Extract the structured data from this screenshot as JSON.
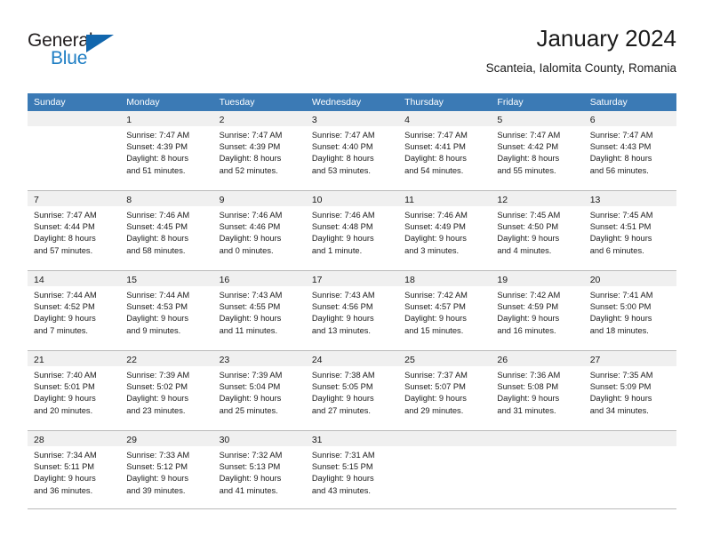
{
  "brand": {
    "name_part1": "General",
    "name_part2": "Blue",
    "logo_icon": "blue-triangle-icon"
  },
  "header": {
    "title": "January 2024",
    "subtitle": "Scanteia, Ialomita County, Romania",
    "accent_color": "#3b7ab5",
    "brand_blue": "#1f7ec4"
  },
  "calendar": {
    "weekday_headers": [
      "Sunday",
      "Monday",
      "Tuesday",
      "Wednesday",
      "Thursday",
      "Friday",
      "Saturday"
    ],
    "weeks": [
      [
        {
          "day": "",
          "sunrise": "",
          "sunset": "",
          "daylight1": "",
          "daylight2": ""
        },
        {
          "day": "1",
          "sunrise": "Sunrise: 7:47 AM",
          "sunset": "Sunset: 4:39 PM",
          "daylight1": "Daylight: 8 hours",
          "daylight2": "and 51 minutes."
        },
        {
          "day": "2",
          "sunrise": "Sunrise: 7:47 AM",
          "sunset": "Sunset: 4:39 PM",
          "daylight1": "Daylight: 8 hours",
          "daylight2": "and 52 minutes."
        },
        {
          "day": "3",
          "sunrise": "Sunrise: 7:47 AM",
          "sunset": "Sunset: 4:40 PM",
          "daylight1": "Daylight: 8 hours",
          "daylight2": "and 53 minutes."
        },
        {
          "day": "4",
          "sunrise": "Sunrise: 7:47 AM",
          "sunset": "Sunset: 4:41 PM",
          "daylight1": "Daylight: 8 hours",
          "daylight2": "and 54 minutes."
        },
        {
          "day": "5",
          "sunrise": "Sunrise: 7:47 AM",
          "sunset": "Sunset: 4:42 PM",
          "daylight1": "Daylight: 8 hours",
          "daylight2": "and 55 minutes."
        },
        {
          "day": "6",
          "sunrise": "Sunrise: 7:47 AM",
          "sunset": "Sunset: 4:43 PM",
          "daylight1": "Daylight: 8 hours",
          "daylight2": "and 56 minutes."
        }
      ],
      [
        {
          "day": "7",
          "sunrise": "Sunrise: 7:47 AM",
          "sunset": "Sunset: 4:44 PM",
          "daylight1": "Daylight: 8 hours",
          "daylight2": "and 57 minutes."
        },
        {
          "day": "8",
          "sunrise": "Sunrise: 7:46 AM",
          "sunset": "Sunset: 4:45 PM",
          "daylight1": "Daylight: 8 hours",
          "daylight2": "and 58 minutes."
        },
        {
          "day": "9",
          "sunrise": "Sunrise: 7:46 AM",
          "sunset": "Sunset: 4:46 PM",
          "daylight1": "Daylight: 9 hours",
          "daylight2": "and 0 minutes."
        },
        {
          "day": "10",
          "sunrise": "Sunrise: 7:46 AM",
          "sunset": "Sunset: 4:48 PM",
          "daylight1": "Daylight: 9 hours",
          "daylight2": "and 1 minute."
        },
        {
          "day": "11",
          "sunrise": "Sunrise: 7:46 AM",
          "sunset": "Sunset: 4:49 PM",
          "daylight1": "Daylight: 9 hours",
          "daylight2": "and 3 minutes."
        },
        {
          "day": "12",
          "sunrise": "Sunrise: 7:45 AM",
          "sunset": "Sunset: 4:50 PM",
          "daylight1": "Daylight: 9 hours",
          "daylight2": "and 4 minutes."
        },
        {
          "day": "13",
          "sunrise": "Sunrise: 7:45 AM",
          "sunset": "Sunset: 4:51 PM",
          "daylight1": "Daylight: 9 hours",
          "daylight2": "and 6 minutes."
        }
      ],
      [
        {
          "day": "14",
          "sunrise": "Sunrise: 7:44 AM",
          "sunset": "Sunset: 4:52 PM",
          "daylight1": "Daylight: 9 hours",
          "daylight2": "and 7 minutes."
        },
        {
          "day": "15",
          "sunrise": "Sunrise: 7:44 AM",
          "sunset": "Sunset: 4:53 PM",
          "daylight1": "Daylight: 9 hours",
          "daylight2": "and 9 minutes."
        },
        {
          "day": "16",
          "sunrise": "Sunrise: 7:43 AM",
          "sunset": "Sunset: 4:55 PM",
          "daylight1": "Daylight: 9 hours",
          "daylight2": "and 11 minutes."
        },
        {
          "day": "17",
          "sunrise": "Sunrise: 7:43 AM",
          "sunset": "Sunset: 4:56 PM",
          "daylight1": "Daylight: 9 hours",
          "daylight2": "and 13 minutes."
        },
        {
          "day": "18",
          "sunrise": "Sunrise: 7:42 AM",
          "sunset": "Sunset: 4:57 PM",
          "daylight1": "Daylight: 9 hours",
          "daylight2": "and 15 minutes."
        },
        {
          "day": "19",
          "sunrise": "Sunrise: 7:42 AM",
          "sunset": "Sunset: 4:59 PM",
          "daylight1": "Daylight: 9 hours",
          "daylight2": "and 16 minutes."
        },
        {
          "day": "20",
          "sunrise": "Sunrise: 7:41 AM",
          "sunset": "Sunset: 5:00 PM",
          "daylight1": "Daylight: 9 hours",
          "daylight2": "and 18 minutes."
        }
      ],
      [
        {
          "day": "21",
          "sunrise": "Sunrise: 7:40 AM",
          "sunset": "Sunset: 5:01 PM",
          "daylight1": "Daylight: 9 hours",
          "daylight2": "and 20 minutes."
        },
        {
          "day": "22",
          "sunrise": "Sunrise: 7:39 AM",
          "sunset": "Sunset: 5:02 PM",
          "daylight1": "Daylight: 9 hours",
          "daylight2": "and 23 minutes."
        },
        {
          "day": "23",
          "sunrise": "Sunrise: 7:39 AM",
          "sunset": "Sunset: 5:04 PM",
          "daylight1": "Daylight: 9 hours",
          "daylight2": "and 25 minutes."
        },
        {
          "day": "24",
          "sunrise": "Sunrise: 7:38 AM",
          "sunset": "Sunset: 5:05 PM",
          "daylight1": "Daylight: 9 hours",
          "daylight2": "and 27 minutes."
        },
        {
          "day": "25",
          "sunrise": "Sunrise: 7:37 AM",
          "sunset": "Sunset: 5:07 PM",
          "daylight1": "Daylight: 9 hours",
          "daylight2": "and 29 minutes."
        },
        {
          "day": "26",
          "sunrise": "Sunrise: 7:36 AM",
          "sunset": "Sunset: 5:08 PM",
          "daylight1": "Daylight: 9 hours",
          "daylight2": "and 31 minutes."
        },
        {
          "day": "27",
          "sunrise": "Sunrise: 7:35 AM",
          "sunset": "Sunset: 5:09 PM",
          "daylight1": "Daylight: 9 hours",
          "daylight2": "and 34 minutes."
        }
      ],
      [
        {
          "day": "28",
          "sunrise": "Sunrise: 7:34 AM",
          "sunset": "Sunset: 5:11 PM",
          "daylight1": "Daylight: 9 hours",
          "daylight2": "and 36 minutes."
        },
        {
          "day": "29",
          "sunrise": "Sunrise: 7:33 AM",
          "sunset": "Sunset: 5:12 PM",
          "daylight1": "Daylight: 9 hours",
          "daylight2": "and 39 minutes."
        },
        {
          "day": "30",
          "sunrise": "Sunrise: 7:32 AM",
          "sunset": "Sunset: 5:13 PM",
          "daylight1": "Daylight: 9 hours",
          "daylight2": "and 41 minutes."
        },
        {
          "day": "31",
          "sunrise": "Sunrise: 7:31 AM",
          "sunset": "Sunset: 5:15 PM",
          "daylight1": "Daylight: 9 hours",
          "daylight2": "and 43 minutes."
        },
        {
          "day": "",
          "sunrise": "",
          "sunset": "",
          "daylight1": "",
          "daylight2": ""
        },
        {
          "day": "",
          "sunrise": "",
          "sunset": "",
          "daylight1": "",
          "daylight2": ""
        },
        {
          "day": "",
          "sunrise": "",
          "sunset": "",
          "daylight1": "",
          "daylight2": ""
        }
      ]
    ]
  }
}
